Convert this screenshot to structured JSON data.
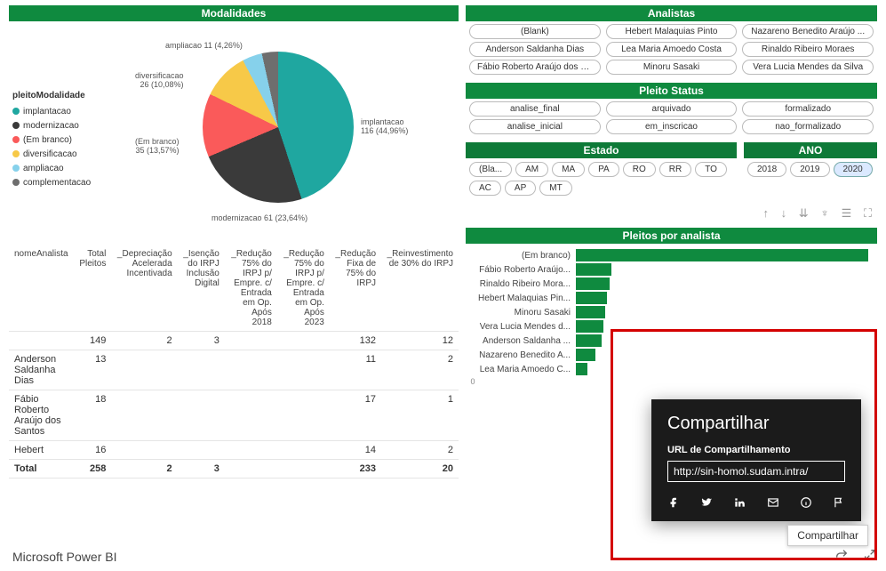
{
  "left": {
    "modalidades_title": "Modalidades",
    "legend_title": "pleitoModalidade",
    "legend": [
      {
        "label": "implantacao",
        "color": "#1fa7a0"
      },
      {
        "label": "modernizacao",
        "color": "#3a3a3a"
      },
      {
        "label": "(Em branco)",
        "color": "#fa5a5a"
      },
      {
        "label": "diversificacao",
        "color": "#f7c948"
      },
      {
        "label": "ampliacao",
        "color": "#86d1eb"
      },
      {
        "label": "complementacao",
        "color": "#6e6e6e"
      }
    ],
    "pie_labels": {
      "implantacao": "implantacao\n116 (44,96%)",
      "modernizacao": "modernizacao 61 (23,64%)",
      "branco": "(Em branco)\n35 (13,57%)",
      "diversificacao": "diversificacao\n26 (10,08%)",
      "ampliacao": "ampliacao 11 (4,26%)"
    },
    "table": {
      "cols": [
        "nomeAnalista",
        "Total Pleitos",
        "_Depreciação Acelerada Incentivada",
        "_Isenção do IRPJ Inclusão Digital",
        "_Redução 75% do IRPJ p/ Empre. c/ Entrada em Op. Após 2018",
        "_Redução 75% do IRPJ p/ Empre. c/ Entrada em Op. Após 2023",
        "_Redução Fixa de 75% do IRPJ",
        "_Reinvestimento de 30% do IRPJ"
      ],
      "rows": [
        [
          "",
          "149",
          "2",
          "3",
          "",
          "",
          "132",
          "12"
        ],
        [
          "Anderson Saldanha Dias",
          "13",
          "",
          "",
          "",
          "",
          "11",
          "2"
        ],
        [
          "Fábio Roberto Araújo dos Santos",
          "18",
          "",
          "",
          "",
          "",
          "17",
          "1"
        ],
        [
          "Hebert",
          "16",
          "",
          "",
          "",
          "",
          "14",
          "2"
        ]
      ],
      "footer": [
        "Total",
        "258",
        "2",
        "3",
        "",
        "",
        "233",
        "20"
      ]
    }
  },
  "right": {
    "analistas_title": "Analistas",
    "analistas": [
      [
        "(Blank)",
        "Hebert Malaquias Pinto",
        "Nazareno Benedito Araújo ..."
      ],
      [
        "Anderson Saldanha Dias",
        "Lea Maria Amoedo Costa",
        "Rinaldo Ribeiro Moraes"
      ],
      [
        "Fábio Roberto Araújo dos S...",
        "Minoru Sasaki",
        "Vera Lucia Mendes da Silva"
      ]
    ],
    "status_title": "Pleito Status",
    "status": [
      [
        "analise_final",
        "arquivado",
        "formalizado"
      ],
      [
        "analise_inicial",
        "em_inscricao",
        "nao_formalizado"
      ]
    ],
    "estado_title": "Estado",
    "estados": [
      "(Bla...",
      "AM",
      "MA",
      "PA",
      "RO",
      "RR",
      "TO",
      "AC",
      "AP",
      "MT"
    ],
    "ano_title": "ANO",
    "anos": [
      "2018",
      "2019",
      "2020"
    ],
    "ano_selected": "2020",
    "bars_title": "Pleitos por analista",
    "axis_0": "0"
  },
  "chart_data": [
    {
      "type": "pie",
      "title": "Modalidades",
      "series": [
        {
          "name": "implantacao",
          "value": 116,
          "pct": 44.96,
          "color": "#1fa7a0"
        },
        {
          "name": "modernizacao",
          "value": 61,
          "pct": 23.64,
          "color": "#3a3a3a"
        },
        {
          "name": "(Em branco)",
          "value": 35,
          "pct": 13.57,
          "color": "#fa5a5a"
        },
        {
          "name": "diversificacao",
          "value": 26,
          "pct": 10.08,
          "color": "#f7c948"
        },
        {
          "name": "ampliacao",
          "value": 11,
          "pct": 4.26,
          "color": "#86d1eb"
        },
        {
          "name": "complementacao",
          "value": 9,
          "pct": 3.49,
          "color": "#6e6e6e"
        }
      ]
    },
    {
      "type": "bar",
      "title": "Pleitos por analista",
      "categories": [
        "(Em branco)",
        "Fábio Roberto Araújo...",
        "Rinaldo Ribeiro Mora...",
        "Hebert Malaquias Pin...",
        "Minoru Sasaki",
        "Vera Lucia Mendes d...",
        "Anderson Saldanha ...",
        "Nazareno Benedito A...",
        "Lea Maria Amoedo C..."
      ],
      "values": [
        149,
        18,
        17,
        16,
        15,
        14,
        13,
        10,
        6
      ],
      "xlim": [
        0,
        150
      ]
    }
  ],
  "share": {
    "title": "Compartilhar",
    "subtitle": "URL de Compartilhamento",
    "url": "http://sin-homol.sudam.intra/",
    "tooltip": "Compartilhar"
  },
  "footer": {
    "brand": "Microsoft Power BI"
  }
}
